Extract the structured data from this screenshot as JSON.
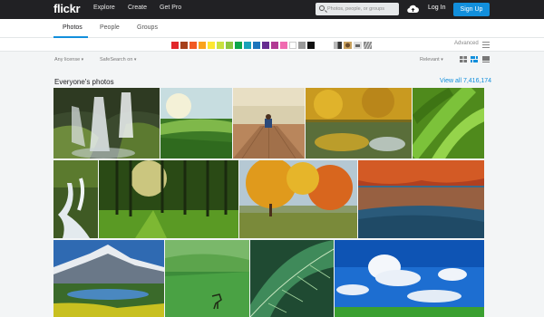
{
  "brand": {
    "logo_text": "flickr"
  },
  "topnav": {
    "items": [
      "Explore",
      "Create",
      "Get Pro"
    ]
  },
  "search": {
    "placeholder": "Photos, people, or groups"
  },
  "account": {
    "login_label": "Log In",
    "signup_label": "Sign Up"
  },
  "tabs": {
    "items": [
      "Photos",
      "People",
      "Groups"
    ],
    "active": "Photos"
  },
  "color_filters": [
    "#e1272b",
    "#a6401b",
    "#f15a22",
    "#faa31b",
    "#fde731",
    "#c9e13f",
    "#8cc63f",
    "#0ca64a",
    "#1aa2b9",
    "#1c75bc",
    "#662d91",
    "#b23a94",
    "#f06bb0",
    "#ffffff",
    "#999999",
    "#111111"
  ],
  "style_filters": [
    "black-and-white",
    "shallow-depth-of-field",
    "minimalist",
    "patterns"
  ],
  "filters": {
    "advanced_label": "Advanced",
    "license_label": "Any license",
    "safesearch_label": "SafeSearch on",
    "sort_label": "Relevant"
  },
  "view_modes": [
    "grid-icon",
    "justified-icon",
    "list-icon"
  ],
  "section": {
    "title": "Everyone's photos",
    "view_all": "View all 7,416,174"
  },
  "colors": {
    "topbar": "#212124",
    "accent": "#128fdc",
    "page_bg": "#f3f5f6"
  },
  "photos": [
    "waterfall-moss",
    "green-field-sunlit",
    "person-on-pier",
    "autumn-reflection",
    "green-leaves-closeup",
    "waterfall-stream",
    "sunlit-forest",
    "autumn-tree-park",
    "autumn-lake-reflection",
    "mountain-lake",
    "deer-in-meadow",
    "leaf-macro",
    "blue-sky-clouds"
  ]
}
